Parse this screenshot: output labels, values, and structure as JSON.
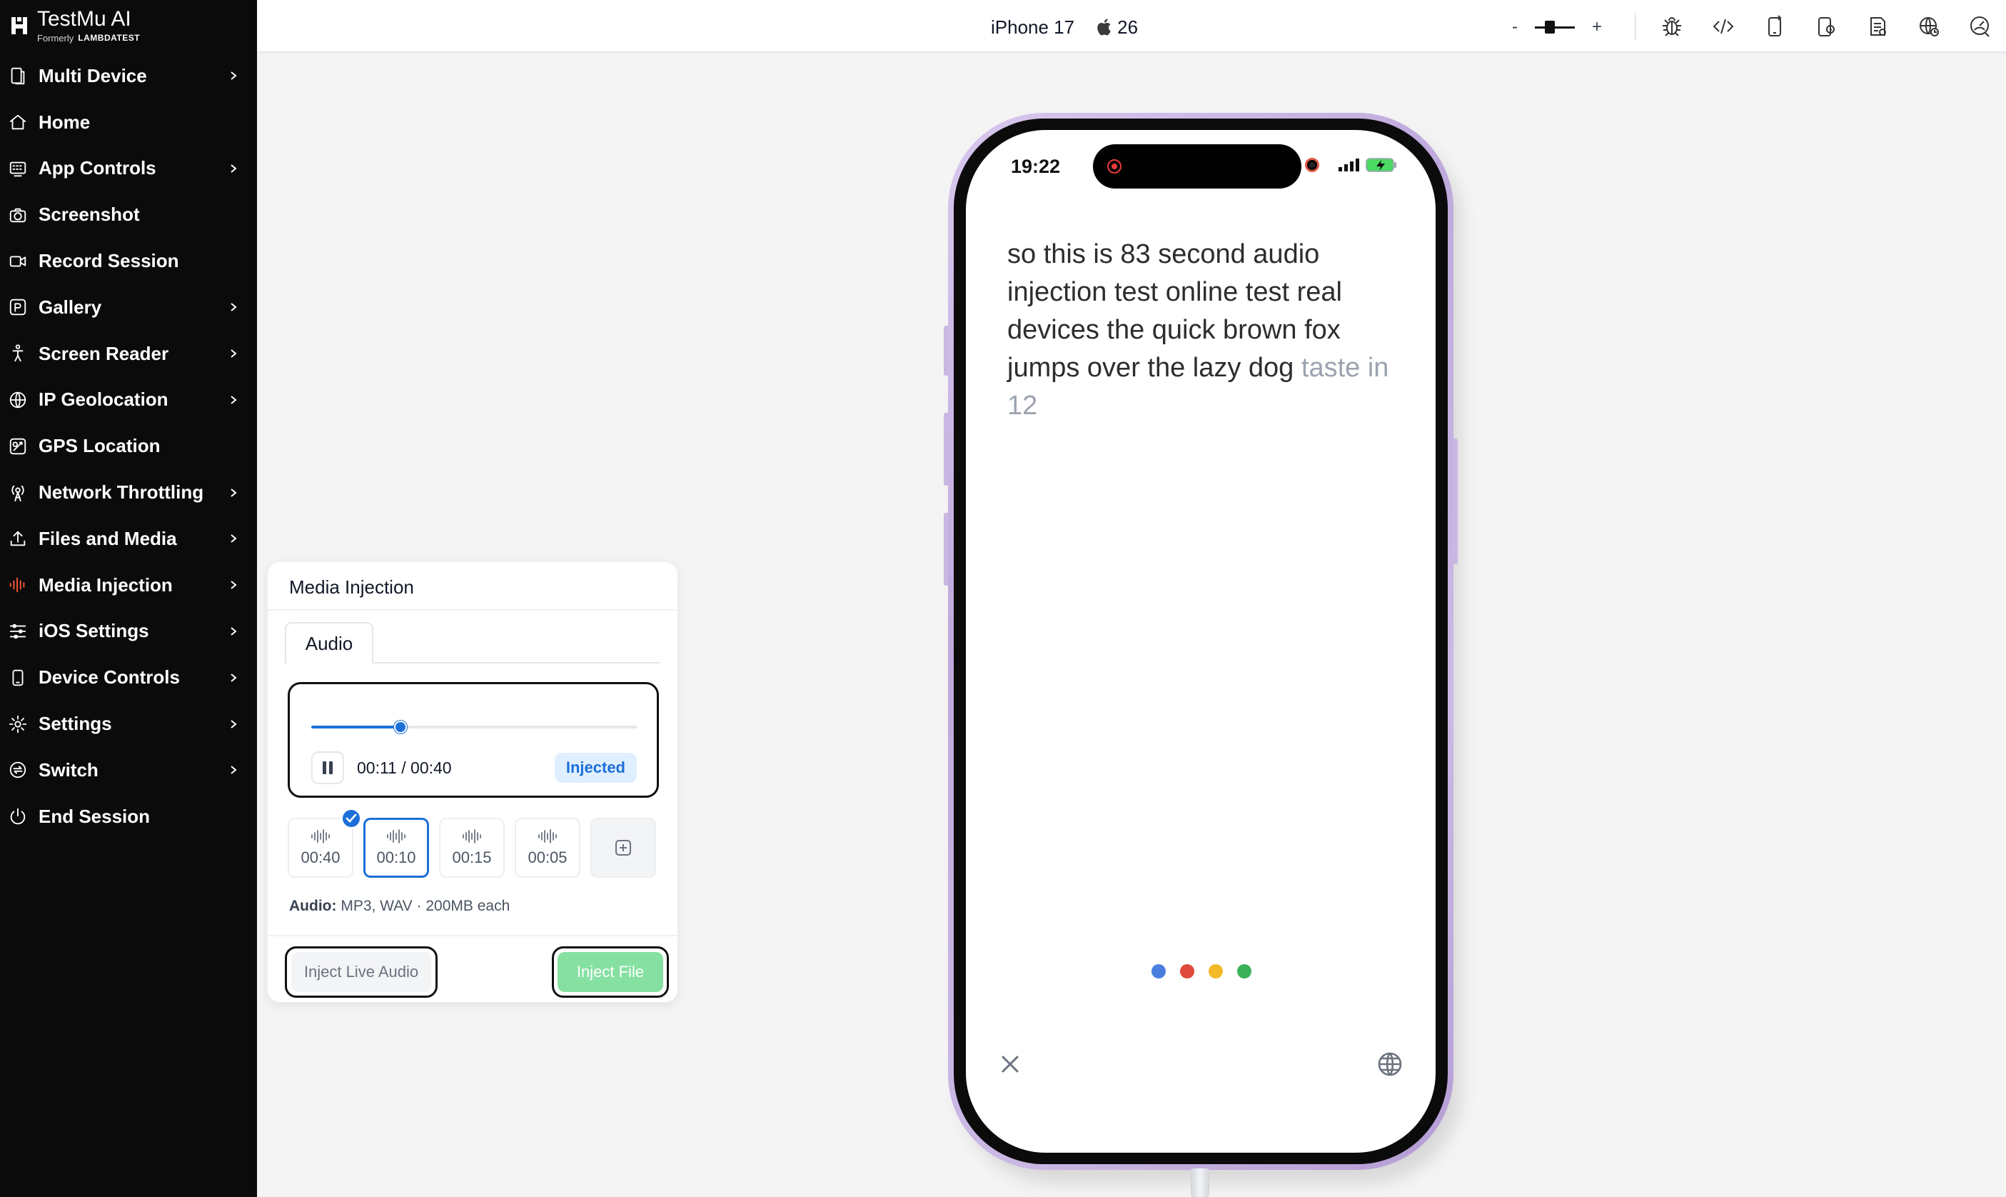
{
  "brand": {
    "name": "TestMu AI",
    "formerly_label": "Formerly",
    "formerly_brand": "LAMBDATEST"
  },
  "sidebar": {
    "items": [
      {
        "label": "Multi Device",
        "icon": "multi-device-icon",
        "has_chevron": true
      },
      {
        "label": "Home",
        "icon": "home-icon",
        "has_chevron": false
      },
      {
        "label": "App Controls",
        "icon": "app-controls-icon",
        "has_chevron": true
      },
      {
        "label": "Screenshot",
        "icon": "camera-icon",
        "has_chevron": false
      },
      {
        "label": "Record Session",
        "icon": "video-camera-icon",
        "has_chevron": false
      },
      {
        "label": "Gallery",
        "icon": "gallery-icon",
        "has_chevron": true
      },
      {
        "label": "Screen Reader",
        "icon": "accessibility-icon",
        "has_chevron": true
      },
      {
        "label": "IP Geolocation",
        "icon": "globe-pin-icon",
        "has_chevron": true
      },
      {
        "label": "GPS Location",
        "icon": "map-pin-icon",
        "has_chevron": false
      },
      {
        "label": "Network Throttling",
        "icon": "antenna-icon",
        "has_chevron": true
      },
      {
        "label": "Files and Media",
        "icon": "upload-icon",
        "has_chevron": true
      },
      {
        "label": "Media Injection",
        "icon": "audio-wave-icon",
        "has_chevron": true,
        "active_color": "#ff5a36"
      },
      {
        "label": "iOS Settings",
        "icon": "sliders-icon",
        "has_chevron": true
      },
      {
        "label": "Device Controls",
        "icon": "phone-icon",
        "has_chevron": true
      },
      {
        "label": "Settings",
        "icon": "gear-icon",
        "has_chevron": true
      },
      {
        "label": "Switch",
        "icon": "switch-icon",
        "has_chevron": true
      },
      {
        "label": "End Session",
        "icon": "power-icon",
        "has_chevron": false
      }
    ]
  },
  "topbar": {
    "device_name": "iPhone 17",
    "os_version": "26",
    "zoom_minus": "-",
    "zoom_plus": "+",
    "tools": [
      "bug-icon",
      "code-icon",
      "rotate-device-icon",
      "device-settings-icon",
      "logs-icon",
      "network-icon",
      "performance-icon"
    ]
  },
  "media_injection": {
    "title": "Media Injection",
    "tab": "Audio",
    "player": {
      "current_time": "00:11",
      "separator": " / ",
      "total_time": "00:40",
      "progress": 0.275,
      "status": "Injected"
    },
    "clips": [
      {
        "duration": "00:40",
        "checked": true,
        "selected": false
      },
      {
        "duration": "00:10",
        "checked": false,
        "selected": true
      },
      {
        "duration": "00:15",
        "checked": false,
        "selected": false
      },
      {
        "duration": "00:05",
        "checked": false,
        "selected": false
      }
    ],
    "formats_label": "Audio:",
    "formats_value": "MP3, WAV · 200MB each",
    "inject_live_label": "Inject Live Audio",
    "inject_file_label": "Inject File",
    "accent": "#1d6fd8"
  },
  "phone": {
    "status_time": "19:22",
    "transcript_final": "so this is 83 second audio injection test online test real devices the quick brown fox jumps over the lazy dog ",
    "transcript_pending": "taste in 12",
    "assistant_dot_colors": [
      "#4a7fe0",
      "#e04a3c",
      "#f3b929",
      "#3bb15a"
    ]
  }
}
